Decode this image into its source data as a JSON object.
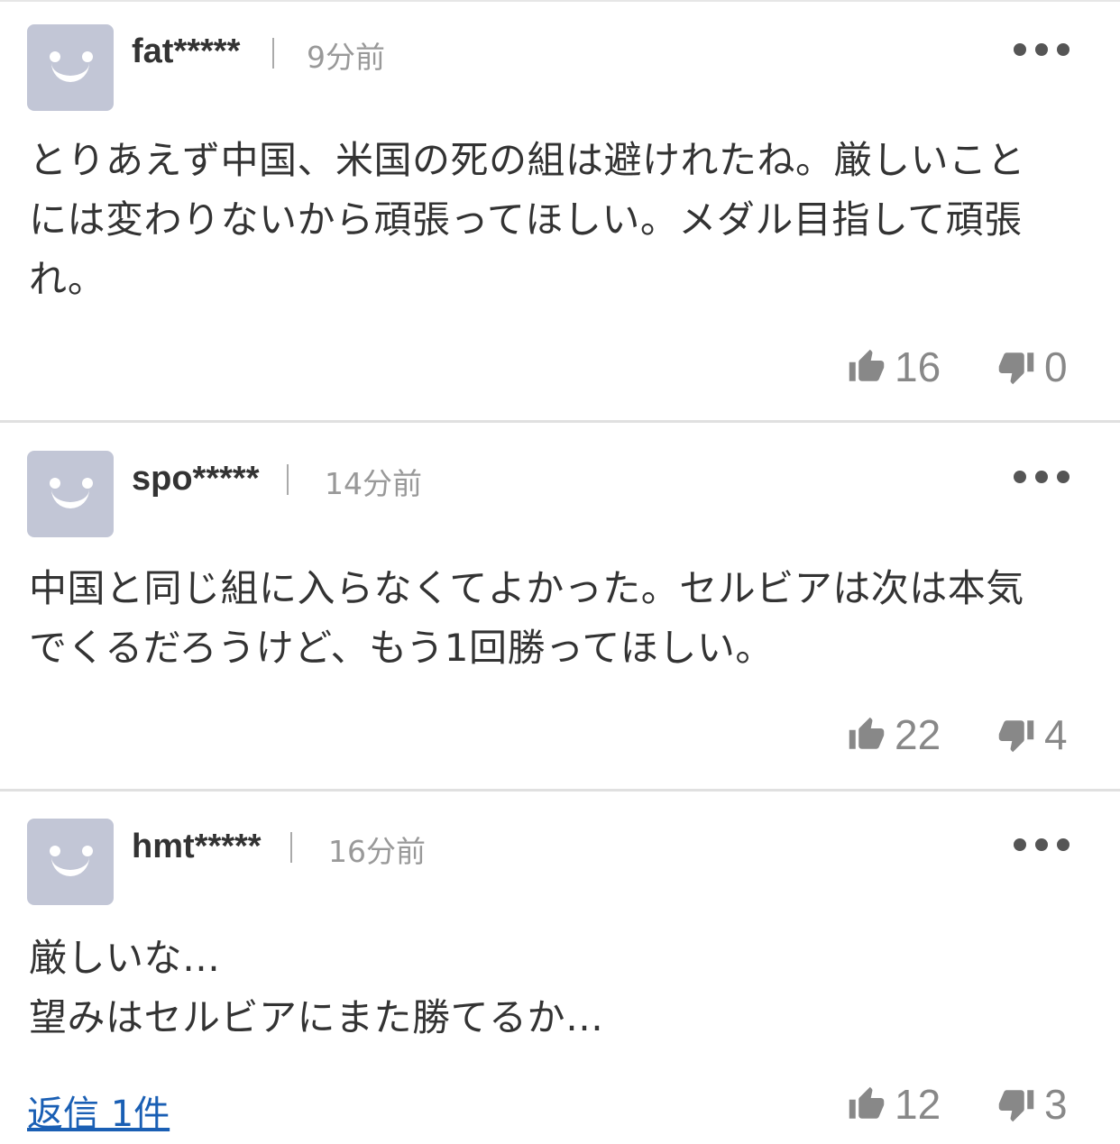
{
  "comments": [
    {
      "username": "fat*****",
      "time": "9分前",
      "text": "とりあえず中国、米国の死の組は避けれたね。厳しいこと\nには変わりないから頑張ってほしい。メダル目指して頑張\nれ。",
      "likes": "16",
      "dislikes": "0"
    },
    {
      "username": "spo*****",
      "time": "14分前",
      "text": "中国と同じ組に入らなくてよかった。セルビアは次は本気\nでくるだろうけど、もう1回勝ってほしい。",
      "likes": "22",
      "dislikes": "4"
    },
    {
      "username": "hmt*****",
      "time": "16分前",
      "text": "厳しいな…\n望みはセルビアにまた勝てるか…",
      "likes": "12",
      "dislikes": "3",
      "reply_label": "返信 1件"
    }
  ],
  "icons": {
    "avatar": "smiley-avatar-icon",
    "more": "more-options-icon",
    "like": "thumbs-up-icon",
    "dislike": "thumbs-down-icon"
  },
  "colors": {
    "avatar_bg": "#c2c6d6",
    "link": "#1a5fb4",
    "meta": "#999999"
  }
}
